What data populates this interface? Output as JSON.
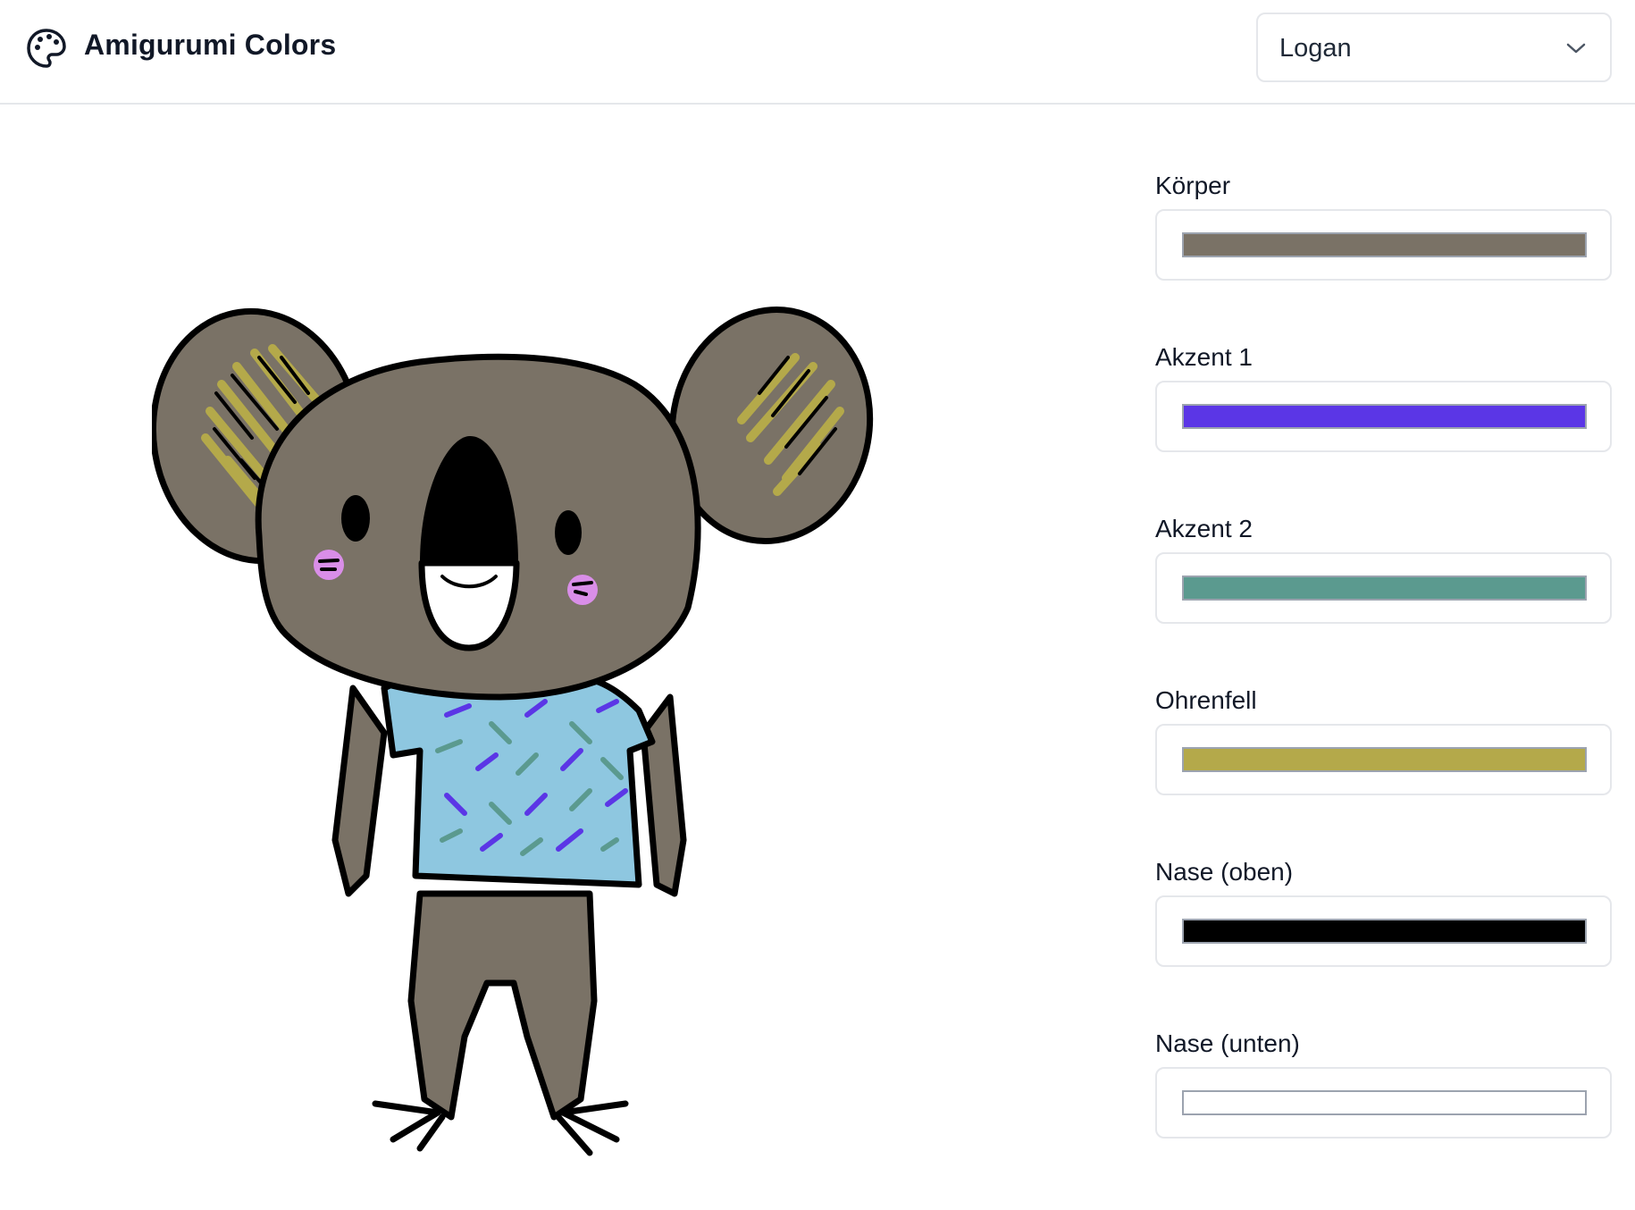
{
  "header": {
    "title": "Amigurumi Colors",
    "logo_icon": "palette-icon",
    "character_select": {
      "value": "Logan",
      "icon": "chevron-down-icon"
    }
  },
  "colors": [
    {
      "label": "Körper",
      "value": "#7a7266"
    },
    {
      "label": "Akzent 1",
      "value": "#5b36e6"
    },
    {
      "label": "Akzent 2",
      "value": "#5b9a8f"
    },
    {
      "label": "Ohrenfell",
      "value": "#b4a94a"
    },
    {
      "label": "Nase (oben)",
      "value": "#000000"
    },
    {
      "label": "Nase (unten)",
      "value": "#ffffff"
    }
  ],
  "illustration": {
    "subject": "koala amigurumi",
    "shirt_color": "#8ec7e0",
    "cheek_color": "#d98ee8"
  }
}
